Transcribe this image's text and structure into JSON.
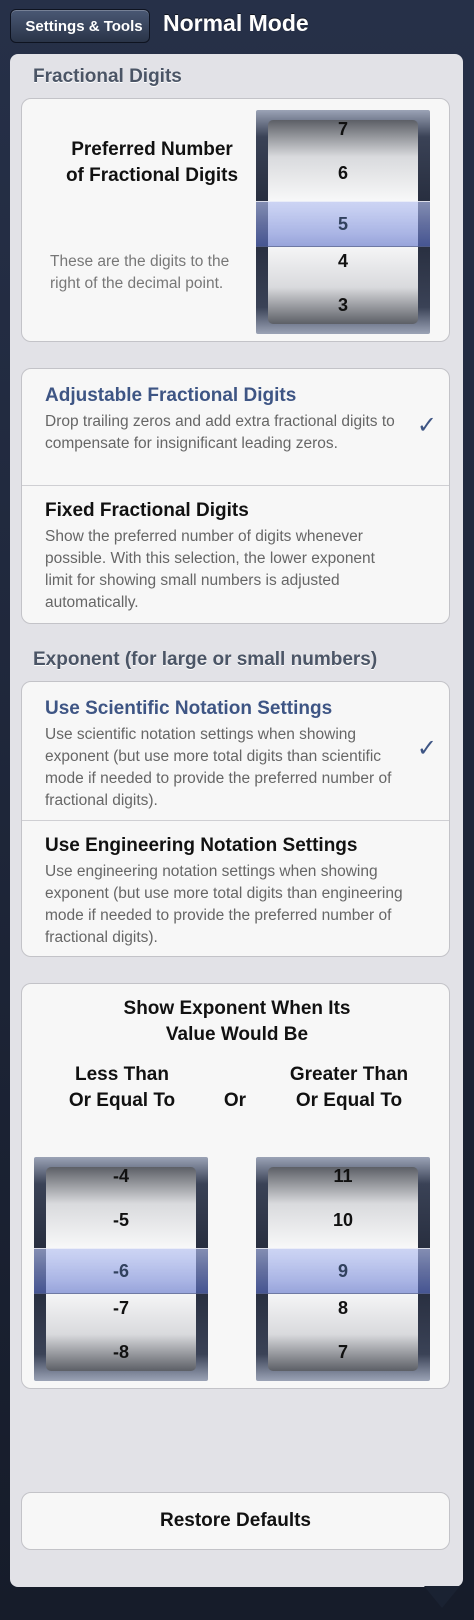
{
  "header": {
    "back_label": "Settings & Tools",
    "title": "Normal Mode"
  },
  "fractional": {
    "section_label": "Fractional Digits",
    "pref_title": "Preferred Number of Fractional Digits",
    "pref_desc": "These are the digits to the right of the decimal point.",
    "picker": {
      "items": [
        "7",
        "6",
        "5",
        "4",
        "3"
      ],
      "selected": "5"
    }
  },
  "fraction_mode": {
    "options": [
      {
        "title": "Adjustable Fractional Digits",
        "desc": "Drop trailing zeros and add extra fractional digits to compensate for insignificant leading zeros.",
        "selected": true
      },
      {
        "title": "Fixed Fractional Digits",
        "desc": "Show the preferred number of digits whenever possible. With this selection, the lower exponent limit for showing small numbers is adjusted automatically.",
        "selected": false
      }
    ]
  },
  "exponent": {
    "section_label": "Exponent (for large or small numbers)",
    "options": [
      {
        "title": "Use Scientific Notation Settings",
        "desc": "Use scientific notation settings when showing exponent (but use more total digits than scientific mode if needed to provide the preferred number of fractional digits).",
        "selected": true
      },
      {
        "title": "Use Engineering Notation Settings",
        "desc": "Use engineering notation settings when showing exponent (but use more total digits than engineering mode if needed to provide the preferred number of fractional digits).",
        "selected": false
      }
    ]
  },
  "show_exponent": {
    "heading": "Show Exponent When Its Value Would Be",
    "less_label": "Less Than Or Equal To",
    "or_label": "Or",
    "greater_label": "Greater Than Or Equal To",
    "less_picker": {
      "items": [
        "-4",
        "-5",
        "-6",
        "-7",
        "-8"
      ],
      "selected": "-6"
    },
    "greater_picker": {
      "items": [
        "11",
        "10",
        "9",
        "8",
        "7"
      ],
      "selected": "9"
    }
  },
  "restore_label": "Restore Defaults",
  "check_glyph": "✓"
}
